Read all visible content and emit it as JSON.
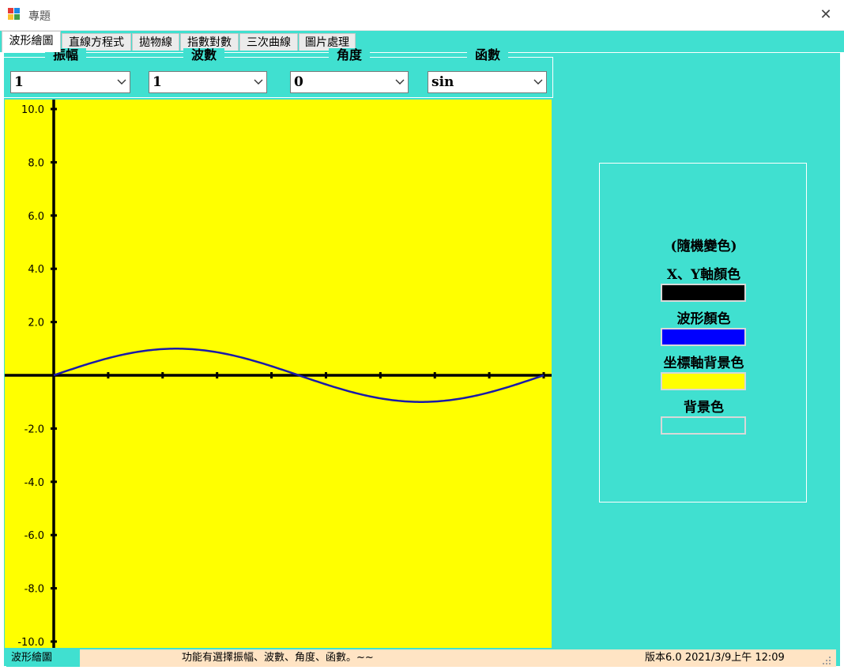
{
  "window": {
    "title": "專題",
    "close_glyph": "✕",
    "icon": "app-window-icon"
  },
  "tabs": [
    {
      "label": "波形繪圖",
      "active": true
    },
    {
      "label": "直線方程式",
      "active": false
    },
    {
      "label": "拋物線",
      "active": false
    },
    {
      "label": "指數對數",
      "active": false
    },
    {
      "label": "三次曲線",
      "active": false
    },
    {
      "label": "圖片處理",
      "active": false
    }
  ],
  "params": {
    "amplitude": {
      "label": "振幅",
      "value": "1"
    },
    "wavenumber": {
      "label": "波數",
      "value": "1"
    },
    "angle": {
      "label": "角度",
      "value": "0"
    },
    "function": {
      "label": "函數",
      "value": "sin"
    }
  },
  "chart_data": {
    "type": "line",
    "function": "sin",
    "amplitude": 1,
    "wavenumber": 1,
    "phase": 0,
    "xlim": [
      0,
      9
    ],
    "ylim": [
      -10,
      10
    ],
    "yticks": [
      "10.0",
      "8.0",
      "6.0",
      "4.0",
      "2.0",
      "-2.0",
      "-4.0",
      "-6.0",
      "-8.0",
      "-10.0"
    ],
    "ytick_values": [
      10,
      8,
      6,
      4,
      2,
      -2,
      -4,
      -6,
      -8,
      -10
    ],
    "colors": {
      "axis": "#000000",
      "wave": "#1a1aa8",
      "background": "#ffff00"
    }
  },
  "color_panel": {
    "heading": "(隨機變色)",
    "items": [
      {
        "label": "X、Y軸顏色",
        "color": "#000000"
      },
      {
        "label": "波形顏色",
        "color": "#0000ff"
      },
      {
        "label": "坐標軸背景色",
        "color": "#ffff00"
      },
      {
        "label": "背景色",
        "color": "#40e0d0"
      }
    ]
  },
  "status": {
    "mode": "波形繪圖",
    "message": "功能有選擇振幅、波數、角度、函數。~~",
    "version": "版本6.0",
    "datetime": "2021/3/9上午 12:09"
  },
  "theme": {
    "background": "#40e0d0",
    "status_bg": "#ffe4c4"
  }
}
